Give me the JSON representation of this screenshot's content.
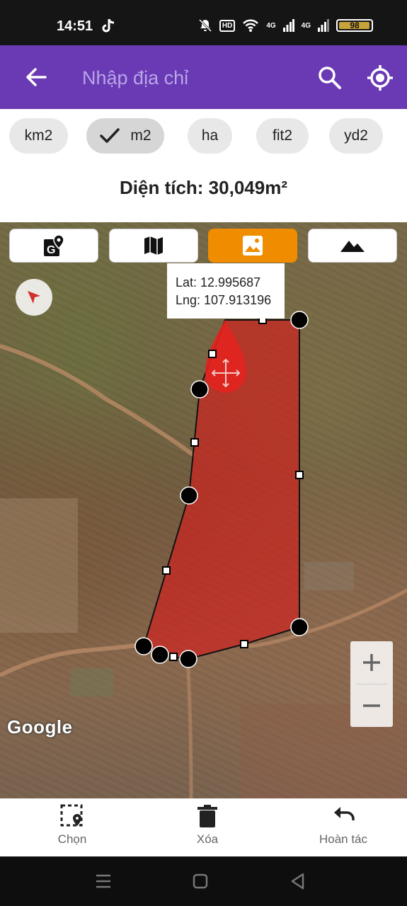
{
  "status_bar": {
    "time": "14:51",
    "hd": "HD",
    "signal_1": "4G",
    "signal_2": "4G",
    "battery_percent": 98
  },
  "app_bar": {
    "search_placeholder": "Nhập địa chỉ",
    "back_icon": "arrow-left-icon",
    "search_icon": "search-icon",
    "locate_icon": "my-location-icon"
  },
  "units": [
    {
      "label": "km2",
      "selected": false
    },
    {
      "label": "m2",
      "selected": true
    },
    {
      "label": "ha",
      "selected": false
    },
    {
      "label": "fit2",
      "selected": false
    },
    {
      "label": "yd2",
      "selected": false
    }
  ],
  "area": {
    "text": "Diện tích: 30,049m²"
  },
  "map": {
    "layer_buttons": [
      {
        "icon": "gps-map-icon",
        "active": false
      },
      {
        "icon": "map-icon",
        "active": false
      },
      {
        "icon": "satellite-image-icon",
        "active": true
      },
      {
        "icon": "terrain-icon",
        "active": false
      }
    ],
    "tooltip": {
      "lat": "Lat: 12.995687",
      "lng": "Lng: 107.913196"
    },
    "google_logo": "Google",
    "polygon_fill": "#d2201e",
    "accent": "#ef8c00"
  },
  "bottom_bar": {
    "select_label": "Chọn",
    "delete_label": "Xóa",
    "undo_label": "Hoàn tác"
  },
  "colors": {
    "app_bar": "#6a3ab5",
    "status_bar": "#151515",
    "chip": "#e8e8e8"
  }
}
